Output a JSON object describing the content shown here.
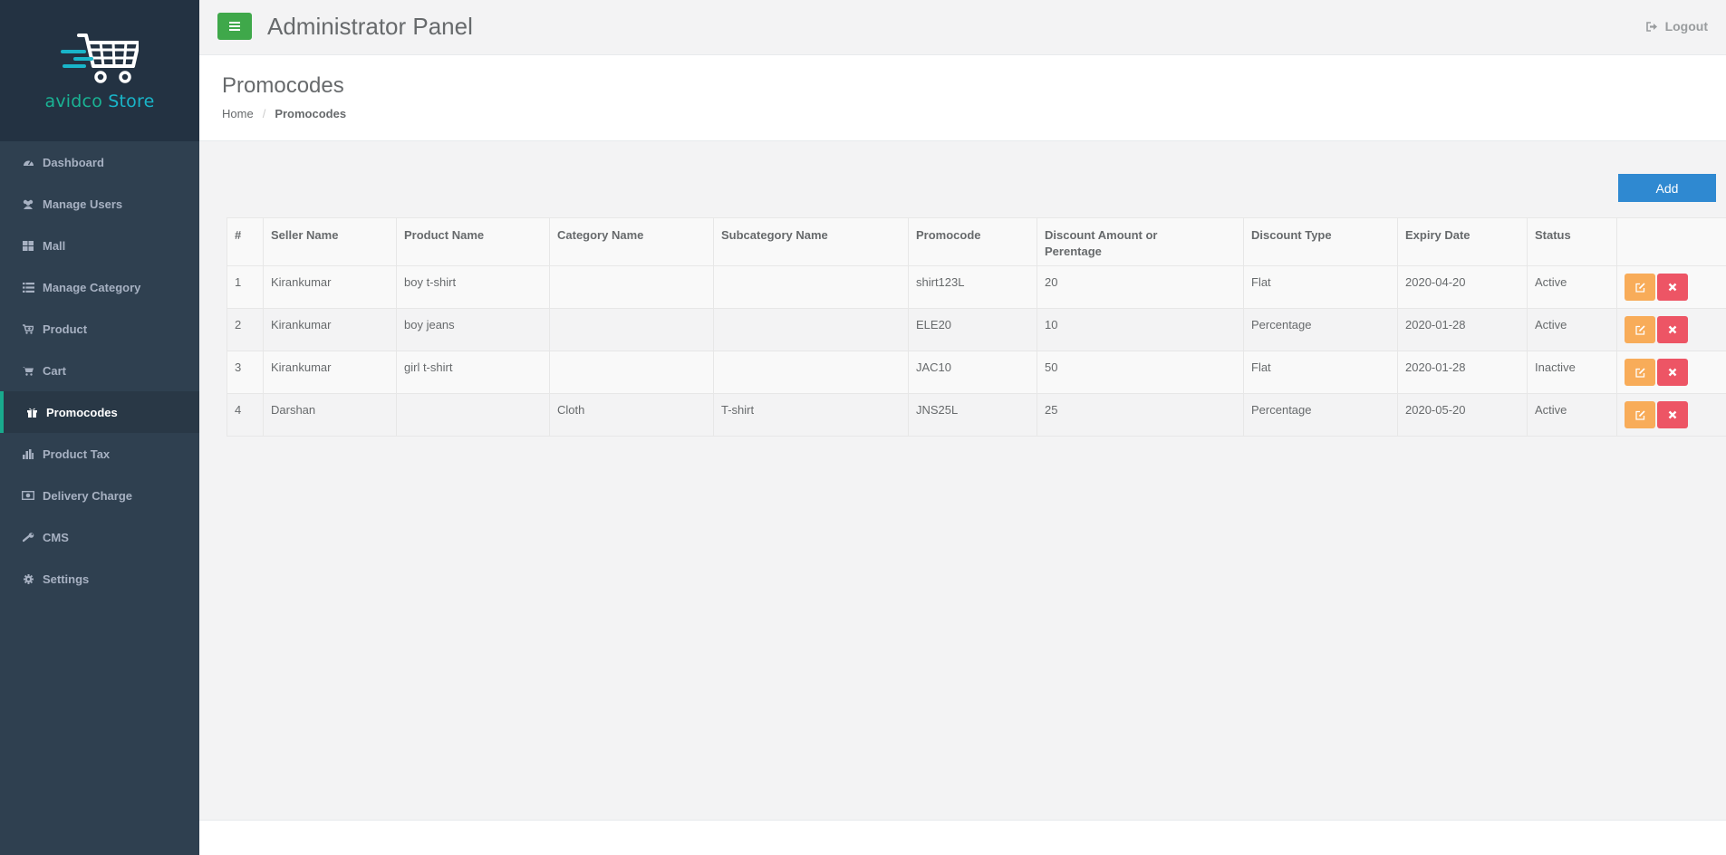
{
  "brand": {
    "name_part1": "avidco",
    "name_part2": " Store",
    "accent": "#19b5c9"
  },
  "sidebar": {
    "items": [
      {
        "label": "Dashboard",
        "icon": "dashboard-icon"
      },
      {
        "label": "Manage Users",
        "icon": "users-icon"
      },
      {
        "label": "Mall",
        "icon": "grid-icon"
      },
      {
        "label": "Manage Category",
        "icon": "list-icon"
      },
      {
        "label": "Product",
        "icon": "cart-plus-icon"
      },
      {
        "label": "Cart",
        "icon": "cart-icon"
      },
      {
        "label": "Promocodes",
        "icon": "gift-icon",
        "active": true
      },
      {
        "label": "Product Tax",
        "icon": "bar-chart-icon"
      },
      {
        "label": "Delivery Charge",
        "icon": "money-icon"
      },
      {
        "label": "CMS",
        "icon": "wrench-icon"
      },
      {
        "label": "Settings",
        "icon": "gear-icon"
      }
    ]
  },
  "header": {
    "title": "Administrator Panel",
    "logout_label": "Logout"
  },
  "page": {
    "title": "Promocodes",
    "breadcrumb": {
      "home": "Home",
      "separator": "/",
      "current": "Promocodes"
    },
    "add_label": "Add"
  },
  "table": {
    "headers": [
      "#",
      "Seller Name",
      "Product Name",
      "Category Name",
      "Subcategory Name",
      "Promocode",
      "Discount Amount or Perentage",
      "Discount Type",
      "Expiry Date",
      "Status",
      ""
    ],
    "rows": [
      [
        "1",
        "Kirankumar",
        "boy t-shirt",
        "",
        "",
        "shirt123L",
        "20",
        "Flat",
        "2020-04-20",
        "Active"
      ],
      [
        "2",
        "Kirankumar",
        "boy jeans",
        "",
        "",
        "ELE20",
        "10",
        "Percentage",
        "2020-01-28",
        "Active"
      ],
      [
        "3",
        "Kirankumar",
        "girl t-shirt",
        "",
        "",
        "JAC10",
        "50",
        "Flat",
        "2020-01-28",
        "Inactive"
      ],
      [
        "4",
        "Darshan",
        "",
        "Cloth",
        "T-shirt",
        "JNS25L",
        "25",
        "Percentage",
        "2020-05-20",
        "Active"
      ]
    ]
  },
  "colors": {
    "sidebar_bg": "#2f4050",
    "active_border": "#19aa8d",
    "menu_button": "#3fa84a",
    "add_button": "#2f89d1",
    "edit_button": "#f8ac59",
    "delete_button": "#ed5565"
  }
}
